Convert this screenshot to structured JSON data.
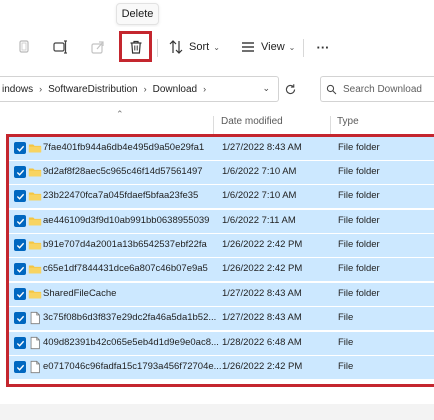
{
  "tooltip": {
    "text": "Delete"
  },
  "toolbar": {
    "sort_label": "Sort",
    "view_label": "View",
    "more_label": "···"
  },
  "address": {
    "crumbs": [
      "indows",
      "SoftwareDistribution",
      "Download"
    ]
  },
  "search": {
    "placeholder": "Search Download"
  },
  "columns": {
    "date_modified": "Date modified",
    "type": "Type"
  },
  "files": [
    {
      "name": "7fae401fb944a6db4e495d9a50e29fa1",
      "date": "1/27/2022 8:43 AM",
      "type": "File folder",
      "icon": "folder-icon"
    },
    {
      "name": "9d2af8f28aec5c965c46f14d57561497",
      "date": "1/6/2022 7:10 AM",
      "type": "File folder",
      "icon": "folder-icon"
    },
    {
      "name": "23b22470fca7a045fdaef5bfaa23fe35",
      "date": "1/6/2022 7:10 AM",
      "type": "File folder",
      "icon": "folder-icon"
    },
    {
      "name": "ae446109d3f9d10ab991bb0638955039",
      "date": "1/6/2022 7:11 AM",
      "type": "File folder",
      "icon": "folder-icon"
    },
    {
      "name": "b91e707d4a2001a13b6542537ebf22fa",
      "date": "1/26/2022 2:42 PM",
      "type": "File folder",
      "icon": "folder-icon"
    },
    {
      "name": "c65e1df7844431dce6a807c46b07e9a5",
      "date": "1/26/2022 2:42 PM",
      "type": "File folder",
      "icon": "folder-icon"
    },
    {
      "name": "SharedFileCache",
      "date": "1/27/2022 8:43 AM",
      "type": "File folder",
      "icon": "folder-icon"
    },
    {
      "name": "3c75f08b6d3f837e29dc2fa46a5da1b52...",
      "date": "1/27/2022 8:43 AM",
      "type": "File",
      "icon": "file-icon"
    },
    {
      "name": "409d82391b42c065e5eb4d1d9e9e0ac8...",
      "date": "1/28/2022 6:48 AM",
      "type": "File",
      "icon": "file-icon"
    },
    {
      "name": "e0717046c96fadfa15c1793a456f72704e...",
      "date": "1/26/2022 2:42 PM",
      "type": "File",
      "icon": "file-icon"
    }
  ],
  "colors": {
    "selection": "#cce8ff",
    "checkbox": "#0067c0",
    "highlight_border": "#c4262e",
    "folder": "#f4c542"
  }
}
